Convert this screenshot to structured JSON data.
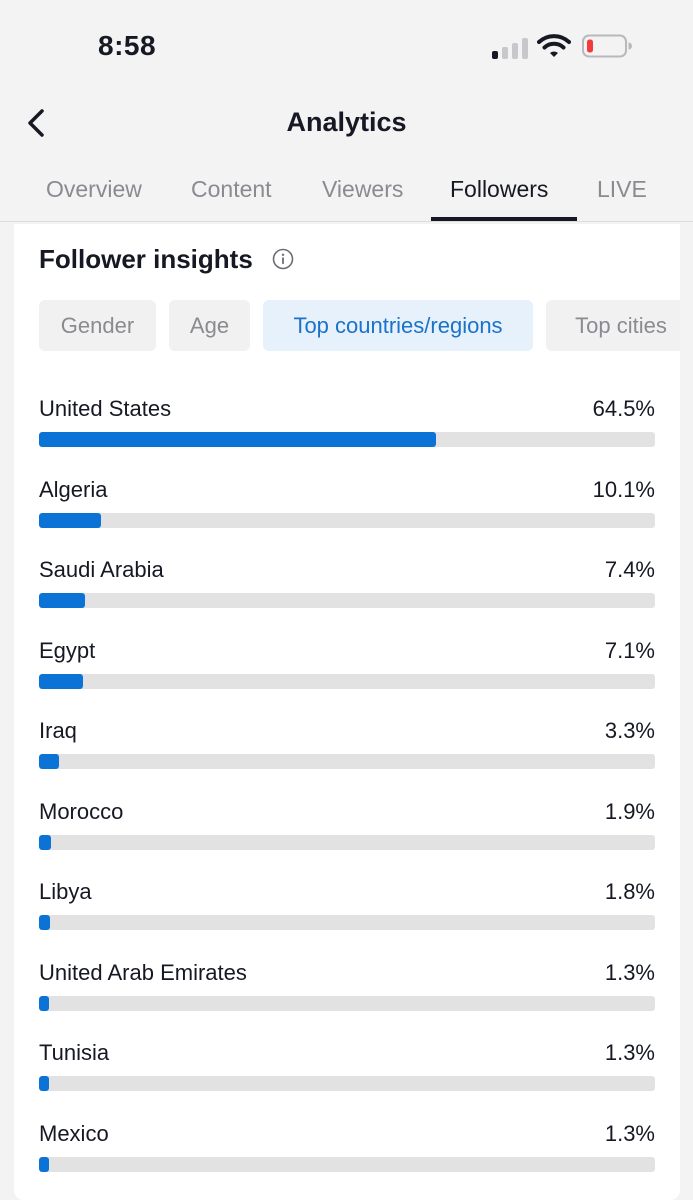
{
  "status": {
    "time": "8:58"
  },
  "header": {
    "title": "Analytics"
  },
  "tabs": [
    {
      "label": "Overview",
      "active": false
    },
    {
      "label": "Content",
      "active": false
    },
    {
      "label": "Viewers",
      "active": false
    },
    {
      "label": "Followers",
      "active": true
    },
    {
      "label": "LIVE",
      "active": false
    }
  ],
  "section": {
    "title": "Follower insights"
  },
  "chips": [
    {
      "label": "Gender",
      "active": false
    },
    {
      "label": "Age",
      "active": false
    },
    {
      "label": "Top countries/regions",
      "active": true
    },
    {
      "label": "Top cities",
      "active": false
    }
  ],
  "countries": [
    {
      "name": "United States",
      "percent_label": "64.5%",
      "value": 64.5
    },
    {
      "name": "Algeria",
      "percent_label": "10.1%",
      "value": 10.1
    },
    {
      "name": "Saudi Arabia",
      "percent_label": "7.4%",
      "value": 7.4
    },
    {
      "name": "Egypt",
      "percent_label": "7.1%",
      "value": 7.1
    },
    {
      "name": "Iraq",
      "percent_label": "3.3%",
      "value": 3.3
    },
    {
      "name": "Morocco",
      "percent_label": "1.9%",
      "value": 1.9
    },
    {
      "name": "Libya",
      "percent_label": "1.8%",
      "value": 1.8
    },
    {
      "name": "United Arab Emirates",
      "percent_label": "1.3%",
      "value": 1.3
    },
    {
      "name": "Tunisia",
      "percent_label": "1.3%",
      "value": 1.3
    },
    {
      "name": "Mexico",
      "percent_label": "1.3%",
      "value": 1.3
    }
  ],
  "colors": {
    "accent": "#0b72d6",
    "chip_active_bg": "#e7f1fb",
    "chip_active_text": "#1a73c8",
    "track": "#e2e2e2",
    "battery_low": "#f23b3b"
  },
  "icons": {
    "signal": "cellular-signal-icon",
    "wifi": "wifi-icon",
    "battery": "battery-low-icon",
    "back": "chevron-left-icon",
    "info": "info-circle-icon"
  }
}
